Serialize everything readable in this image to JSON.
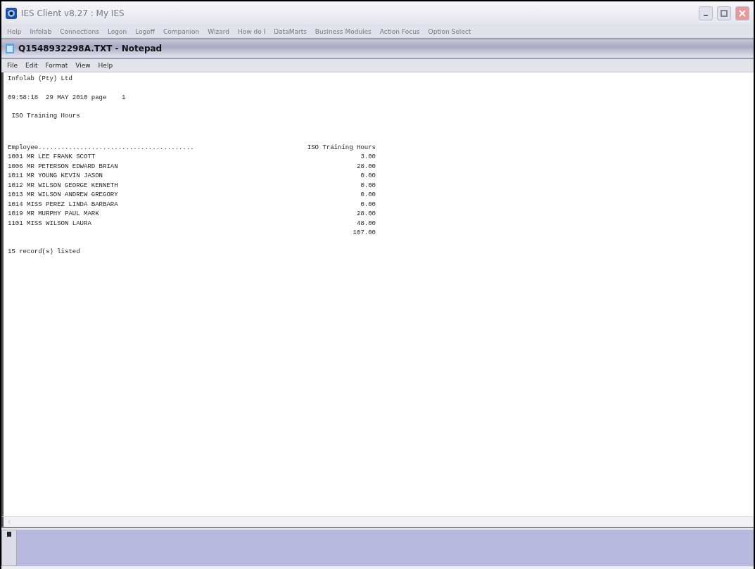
{
  "window": {
    "title": "IES Client v8.27 : My IES"
  },
  "menu": [
    "Help",
    "Infolab",
    "Connections",
    "Logon",
    "Logoff",
    "Companion",
    "Wizard",
    "How do I",
    "DataMarts",
    "Business Modules",
    "Action Focus",
    "Option Select"
  ],
  "notepad": {
    "title": "Q1548932298A.TXT - Notepad",
    "menu": [
      "File",
      "Edit",
      "Format",
      "View",
      "Help"
    ],
    "report": {
      "company": "Infolab (Pty) Ltd",
      "timestamp": "09:58:18  29 MAY 2010 page    1",
      "title": "ISO Training Hours",
      "columns": [
        "Employee.........................................",
        "ISO Training Hours"
      ],
      "rows": [
        {
          "employee": "1001 MR LEE FRANK SCOTT",
          "hours": "3.00"
        },
        {
          "employee": "1006 MR PETERSON EDWARD BRIAN",
          "hours": "28.00"
        },
        {
          "employee": "1011 MR YOUNG KEVIN JASON",
          "hours": "0.00"
        },
        {
          "employee": "1012 MR WILSON GEORGE KENNETH",
          "hours": "0.00"
        },
        {
          "employee": "1013 MR WILSON ANDREW GREGORY",
          "hours": "0.00"
        },
        {
          "employee": "1014 MISS PEREZ LINDA BARBARA",
          "hours": "0.00"
        },
        {
          "employee": "1019 MR MURPHY PAUL MARK",
          "hours": "28.00"
        },
        {
          "employee": "1101 MISS WILSON LAURA",
          "hours": "48.00"
        }
      ],
      "total": "107.00",
      "footer": "15 record(s) listed"
    }
  }
}
